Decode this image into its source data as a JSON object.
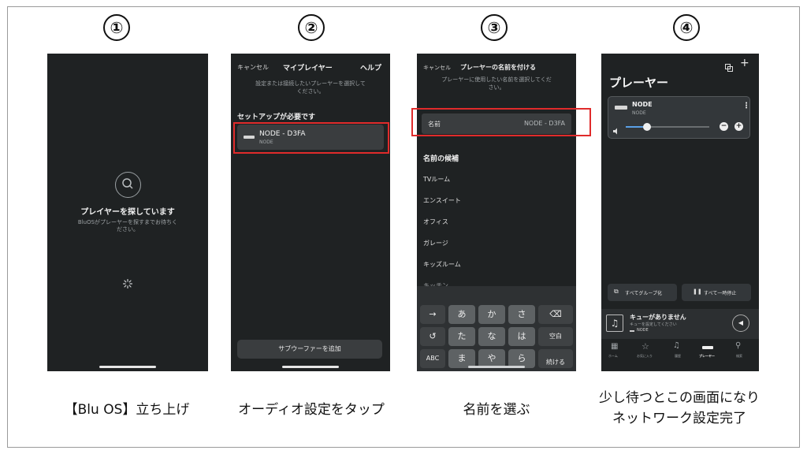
{
  "steps": [
    {
      "number": "①",
      "caption": "【Blu OS】立ち上げ"
    },
    {
      "number": "②",
      "caption": "オーディオ設定をタップ"
    },
    {
      "number": "③",
      "caption": "名前を選ぶ"
    },
    {
      "number": "④",
      "caption_line1": "少し待つとこの画面になり",
      "caption_line2": "ネットワーク設定完了"
    }
  ],
  "screen1": {
    "title": "プレイヤーを探しています",
    "subtitle_line1": "BluOSがプレーヤーを探すまでお待ちく",
    "subtitle_line2": "ださい。",
    "icons": [
      "search-icon",
      "spinner-icon"
    ]
  },
  "screen2": {
    "cancel": "キャンセル",
    "title": "マイプレイヤー",
    "help": "ヘルプ",
    "instruction_line1": "設定または接続したいプレーヤーを選択して",
    "instruction_line2": "ください。",
    "section": "セットアップが必要です",
    "player_name": "NODE - D3FA",
    "player_model": "NODE",
    "add_subwoofer": "サブウーファーを追加"
  },
  "screen3": {
    "cancel": "キャンセル",
    "title": "プレーヤーの名前を付ける",
    "instruction_line1": "プレーヤーに使用したい名前を選択してくだ",
    "instruction_line2": "さい。",
    "name_label": "名前",
    "name_value": "NODE - D3FA",
    "candidates_heading": "名前の候補",
    "candidates": [
      "TVルーム",
      "エンスイート",
      "オフィス",
      "ガレージ",
      "キッズルーム",
      "キッチン"
    ],
    "keyboard": {
      "row1": [
        "→",
        "あ",
        "か",
        "さ",
        "⌫"
      ],
      "row2": [
        "↺",
        "た",
        "な",
        "は",
        "空白"
      ],
      "row3": [
        "ABC",
        "ま",
        "や",
        "ら",
        "続ける"
      ]
    }
  },
  "screen4": {
    "title": "プレーヤー",
    "player_name": "NODE",
    "player_model": "NODE",
    "volume_level": 0.25,
    "group_all": "すべてグループ化",
    "pause_all": "すべて一時停止",
    "queue_title": "キューがありません",
    "queue_subtitle": "キューを設定してください",
    "queue_player": "NODE",
    "tabs": [
      "ホーム",
      "お気に入り",
      "履歴",
      "プレーヤー",
      "検索"
    ],
    "accent": "#5aa0e6"
  }
}
